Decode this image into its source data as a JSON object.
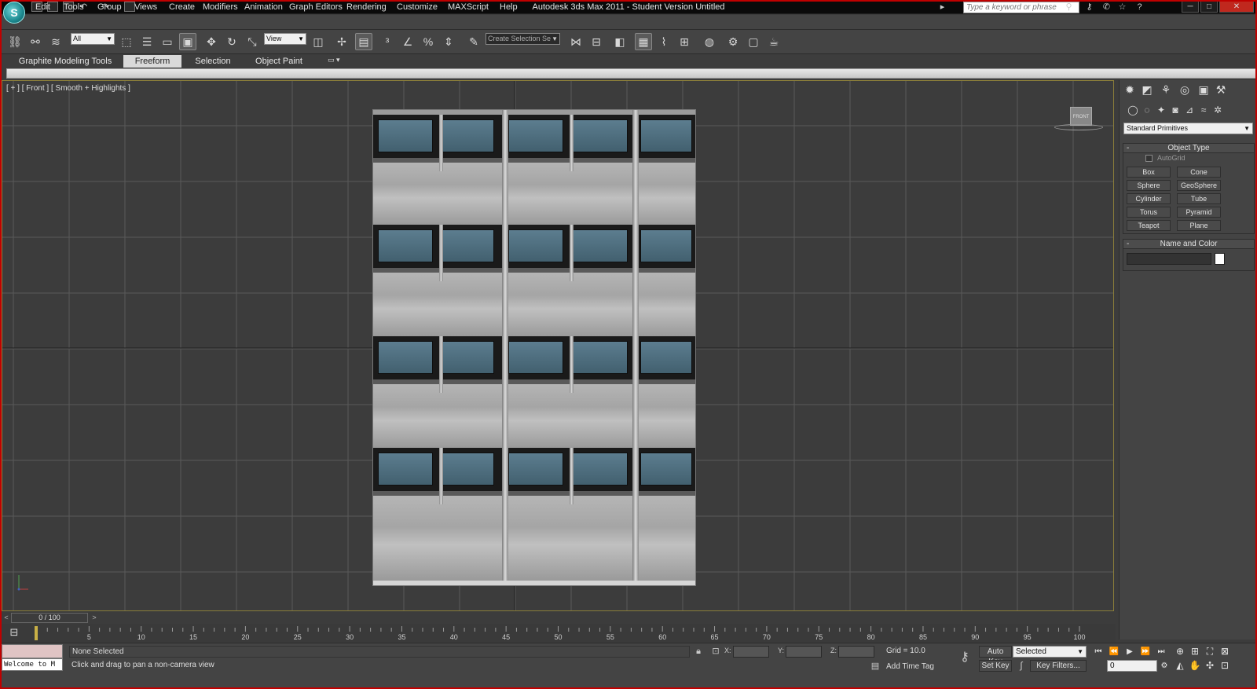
{
  "window": {
    "title": "Autodesk 3ds Max  2011  - Student Version    Untitled",
    "search_placeholder": "Type a keyword or phrase"
  },
  "menu": [
    "Edit",
    "Tools",
    "Group",
    "Views",
    "Create",
    "Modifiers",
    "Animation",
    "Graph Editors",
    "Rendering",
    "Customize",
    "MAXScript",
    "Help"
  ],
  "toolbar": {
    "selection_filter": "All",
    "ref_coord_system": "View",
    "named_selection_set": "Create Selection Se"
  },
  "ribbon": {
    "tabs": [
      "Graphite Modeling Tools",
      "Freeform",
      "Selection",
      "Object Paint"
    ],
    "active_tab": "Freeform"
  },
  "viewport": {
    "label": "[ + ] [ Front ] [ Smooth + Highlights ]",
    "viewcube_label": "FRONT"
  },
  "command_panel": {
    "category": "Standard Primitives",
    "object_type": {
      "header": "Object Type",
      "autogrid_label": "AutoGrid",
      "buttons": [
        "Box",
        "Cone",
        "Sphere",
        "GeoSphere",
        "Cylinder",
        "Tube",
        "Torus",
        "Pyramid",
        "Teapot",
        "Plane"
      ]
    },
    "name_and_color": {
      "header": "Name and Color",
      "color": "#ffffff"
    }
  },
  "time_slider": {
    "position": "0 / 100",
    "ticks": [
      5,
      10,
      15,
      20,
      25,
      30,
      35,
      40,
      45,
      50,
      55,
      60,
      65,
      70,
      75,
      80,
      85,
      90,
      95,
      100
    ]
  },
  "status": {
    "welcome": "Welcome to M",
    "selection": "None Selected",
    "prompt": "Click and drag to pan a non-camera view",
    "x_label": "X:",
    "y_label": "Y:",
    "z_label": "Z:",
    "grid": "Grid = 10.0",
    "add_time_tag": "Add Time Tag",
    "auto_key": "Auto Key",
    "set_key": "Set Key",
    "key_mode": "Selected",
    "key_filters": "Key Filters...",
    "current_frame": "0"
  },
  "colors": {
    "title_bar": "#0a0a0a",
    "ui_gray": "#444444",
    "viewport_bg": "#3c3c3c",
    "viewport_border": "#8a7d3a",
    "window_frame": "#c00000",
    "glass": "#4f6f80"
  }
}
